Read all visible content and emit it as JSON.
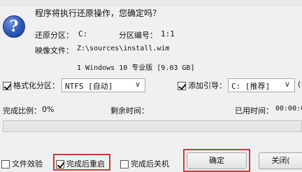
{
  "dialog": {
    "message": "程序将执行还原操作，您确定吗？",
    "restore_partition_label": "还原分区：",
    "restore_partition_value": "C:",
    "partition_number_label": "分区编号：",
    "partition_number_value": "1:1",
    "image_file_label": "映像文件：",
    "image_file_value": "Z:\\sources\\install.wim",
    "image_entry": "1 Windows 10 专业版 [9.03 GB]"
  },
  "options": {
    "format_label": "格式化分区：",
    "format_checked": true,
    "format_value": "NTFS [自动]",
    "boot_label": "添加引导：",
    "boot_checked": true,
    "boot_value": "C: [推荐]",
    "boot_trailing": "(",
    "dropdown_arrow": "∨"
  },
  "progress": {
    "completed_label": "完成比例：",
    "completed_value": "0%",
    "remaining_label": "剩余时间：",
    "remaining_value": "",
    "elapsed_label": "已用时间：",
    "elapsed_value": "00:00:0",
    "fraction": 0,
    "fill_color": "#3aa34a"
  },
  "footer": {
    "verify_label": "文件效验",
    "verify_checked": false,
    "reboot_label": "完成后重启",
    "reboot_checked": true,
    "shutdown_label": "完成后关机",
    "shutdown_checked": false,
    "ok_label": "确定",
    "close_label": "关闭(",
    "highlight_color": "#c93a3a"
  },
  "icons": {
    "question": "question-icon"
  }
}
